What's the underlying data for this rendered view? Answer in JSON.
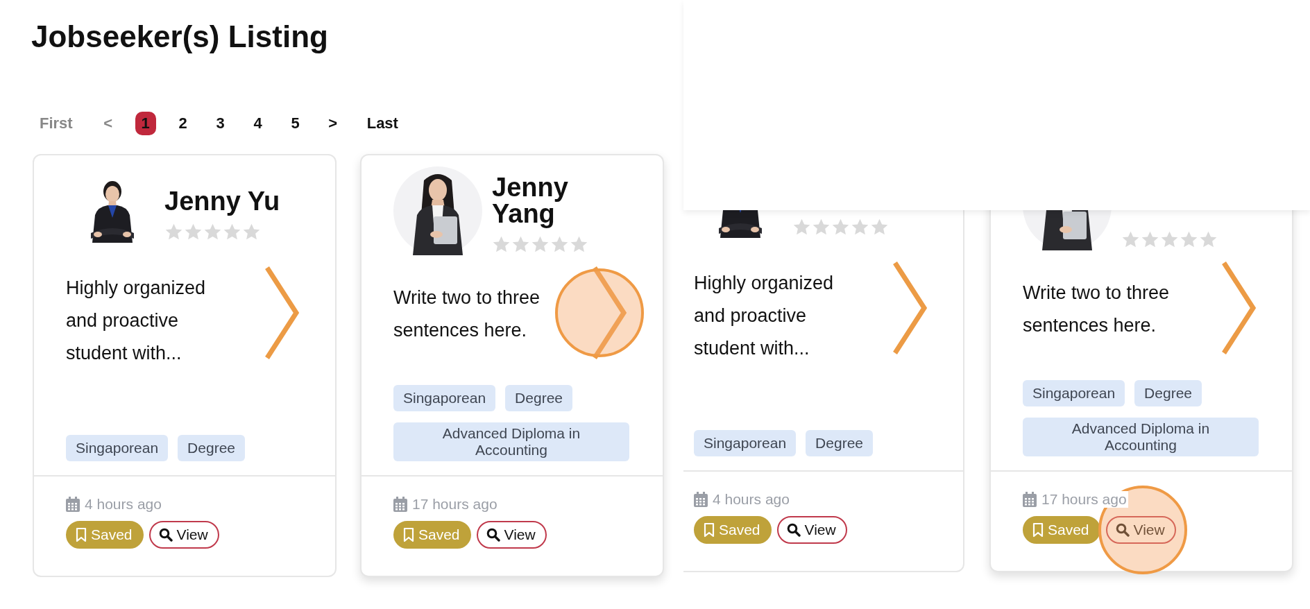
{
  "page_title": "Jobseeker(s) Listing",
  "pagination": [
    {
      "label": "First",
      "selected": false,
      "disabled": true
    },
    {
      "label": "<",
      "selected": false,
      "disabled": true
    },
    {
      "label": "1",
      "selected": true,
      "disabled": false
    },
    {
      "label": "2",
      "selected": false,
      "disabled": false
    },
    {
      "label": "3",
      "selected": false,
      "disabled": false
    },
    {
      "label": "4",
      "selected": false,
      "disabled": false
    },
    {
      "label": "5",
      "selected": false,
      "disabled": false
    },
    {
      "label": ">",
      "selected": false,
      "disabled": false
    },
    {
      "label": "Last",
      "selected": false,
      "disabled": false
    }
  ],
  "cards": [
    {
      "name": "Jenny Yu",
      "round_avatar": false,
      "arrow_tapped": false,
      "raised": false,
      "stars": 0,
      "description": "Highly organized and proactive student with...",
      "tags": [
        {
          "label": "Singaporean",
          "wide": false
        },
        {
          "label": "Degree",
          "wide": false
        }
      ],
      "posted": "4 hours ago",
      "actions": [
        {
          "kind": "save",
          "label": "Saved",
          "saved": true
        },
        {
          "kind": "view",
          "label": "View"
        }
      ]
    },
    {
      "name": "Jenny Yang",
      "round_avatar": true,
      "arrow_tapped": true,
      "raised": true,
      "stars": 0,
      "description": "Write two to three sentences here.",
      "tags": [
        {
          "label": "Singaporean",
          "wide": false
        },
        {
          "label": "Degree",
          "wide": false
        },
        {
          "label": "Advanced Diploma in Accounting",
          "wide": true
        }
      ],
      "posted": "17 hours ago",
      "actions": [
        {
          "kind": "save",
          "label": "Saved",
          "saved": true
        },
        {
          "kind": "view",
          "label": "View",
          "tapped": false
        }
      ]
    }
  ],
  "scrolled_view": {
    "cards": [
      {
        "round_avatar": false,
        "arrow_tapped": false,
        "raised": false,
        "stars": 0,
        "description": "Highly organized and proactive student with...",
        "tags": [
          {
            "label": "Singaporean",
            "wide": false
          },
          {
            "label": "Degree",
            "wide": false
          }
        ],
        "posted": "4 hours ago",
        "actions": [
          {
            "kind": "save",
            "label": "Saved",
            "saved": true
          },
          {
            "kind": "view",
            "label": "View"
          }
        ]
      },
      {
        "round_avatar": true,
        "arrow_tapped": false,
        "raised": true,
        "stars": 0,
        "description": "Write two to three sentences here.",
        "tags": [
          {
            "label": "Singaporean",
            "wide": false
          },
          {
            "label": "Degree",
            "wide": false
          },
          {
            "label": "Advanced Diploma in Accounting",
            "wide": true
          }
        ],
        "posted": "17 hours ago",
        "actions": [
          {
            "kind": "save",
            "label": "Saved",
            "saved": true
          },
          {
            "kind": "view",
            "label": "View",
            "tapped": true
          }
        ]
      }
    ]
  }
}
